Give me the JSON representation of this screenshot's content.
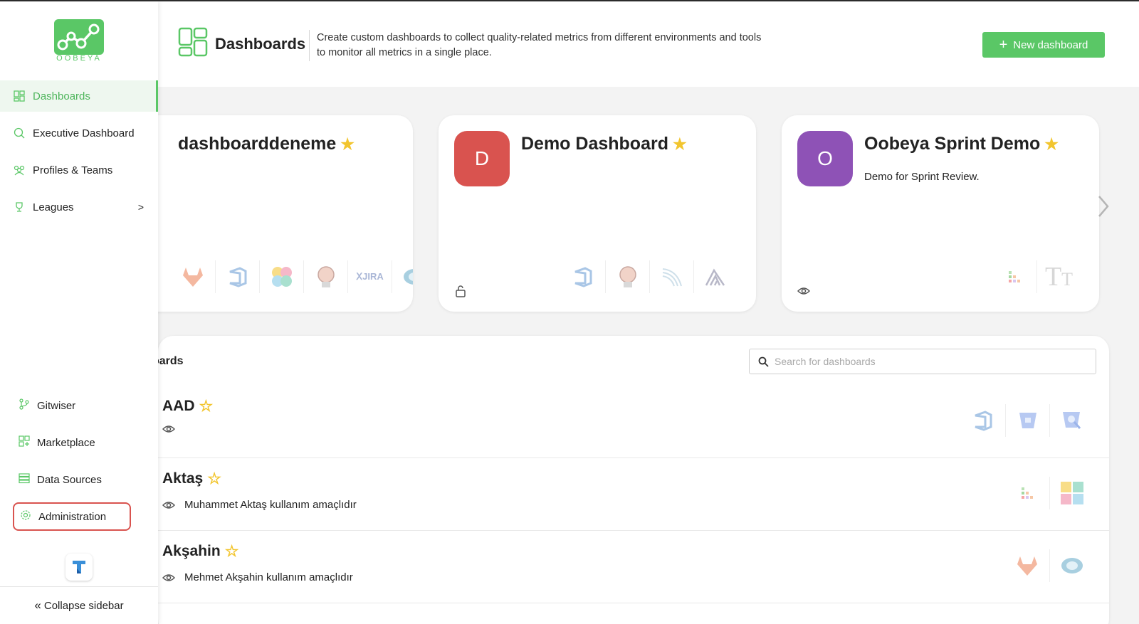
{
  "app": {
    "logo_text": "OOBEYA",
    "accent": "#5ac766"
  },
  "sidebar": {
    "top_items": [
      {
        "label": "Dashboards",
        "icon": "dashboard-icon",
        "active": true
      },
      {
        "label": "Executive Dashboard",
        "icon": "executive-icon"
      },
      {
        "label": "Profiles & Teams",
        "icon": "teams-icon"
      },
      {
        "label": "Leagues",
        "icon": "trophy-icon",
        "chevron": ">"
      }
    ],
    "bottom_items": [
      {
        "label": "Gitwiser",
        "icon": "git-branch-icon"
      },
      {
        "label": "Marketplace",
        "icon": "marketplace-icon"
      },
      {
        "label": "Data Sources",
        "icon": "database-icon"
      },
      {
        "label": "Administration",
        "icon": "gear-icon",
        "highlighted": true
      }
    ],
    "collapse_label": "Collapse sidebar"
  },
  "header": {
    "title": "Dashboards",
    "description": "Create custom dashboards to collect quality-related metrics from different environments and tools to monitor all metrics in a single place.",
    "new_button": "New dashboard"
  },
  "cards": [
    {
      "name": "dashboarddeneme",
      "initial": "",
      "color": "#8e44ad",
      "description": "",
      "icons": [
        "gitlab-icon",
        "azure-devops-icon",
        "elastic-icon",
        "jenkins-icon",
        "jira-icon",
        "eye-ring-icon"
      ],
      "badge": ""
    },
    {
      "name": "Demo Dashboard",
      "initial": "D",
      "color": "#d9534f",
      "description": "",
      "icons": [
        "azure-devops-icon",
        "jenkins-icon",
        "sonar-waves-icon",
        "sentry-icon"
      ],
      "badge": "lock-icon"
    },
    {
      "name": "Oobeya Sprint Demo",
      "initial": "O",
      "color": "#8e52b6",
      "description": "Demo for Sprint Review.",
      "icons": [
        "pixel-grid-icon",
        "text-size-icon"
      ],
      "badge": "eye-icon"
    }
  ],
  "list": {
    "title": "Dashboards",
    "title_visible": "oards",
    "search_placeholder": "Search for dashboards",
    "rows": [
      {
        "name": "AAD",
        "description": "",
        "icons": [
          "azure-devops-icon",
          "bitbucket-icon",
          "bitbucket-search-icon"
        ]
      },
      {
        "name": "Aktaş",
        "description": "Muhammet Aktaş kullanım amaçlıdır",
        "icons": [
          "pixel-grid-icon",
          "puzzle-icon"
        ]
      },
      {
        "name": "Akşahin",
        "description": "Mehmet Akşahin kullanım amaçlıdır",
        "icons": [
          "gitlab-icon",
          "eye-ring-icon"
        ]
      }
    ]
  }
}
